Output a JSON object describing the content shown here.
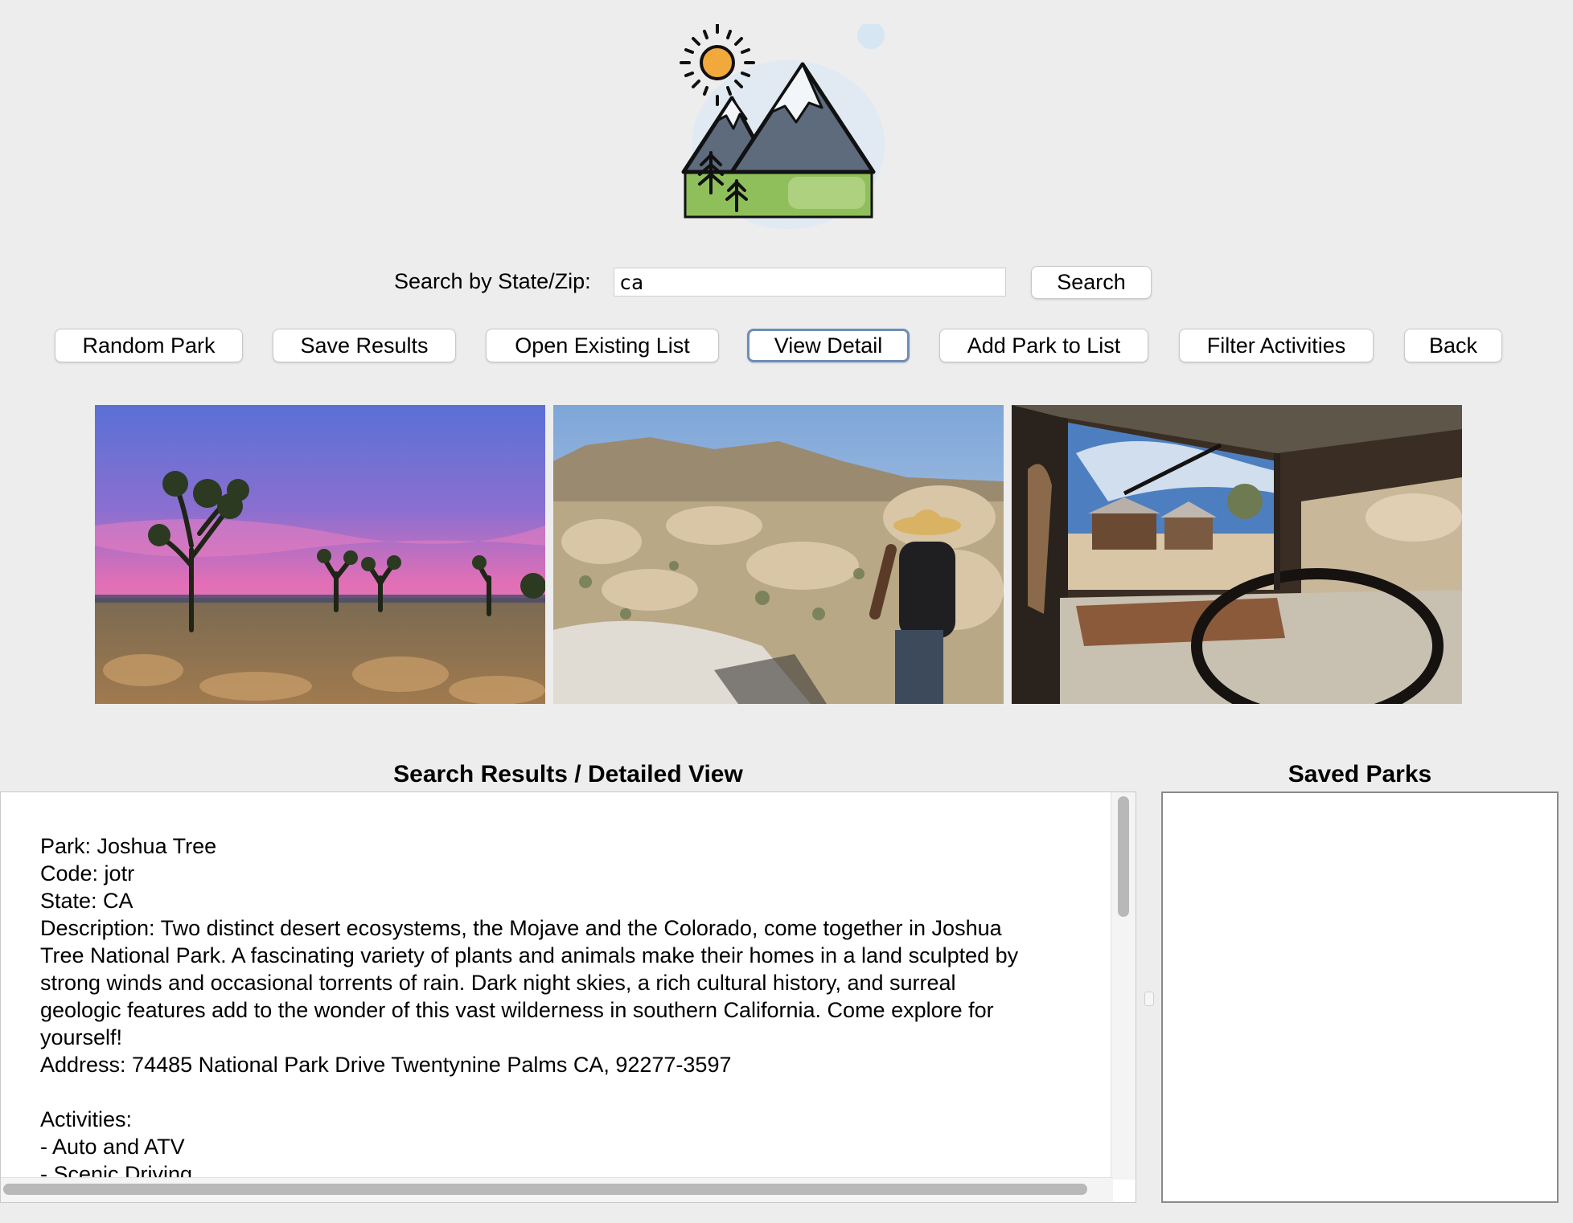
{
  "app": {
    "logo_icon": "mountains-sun-trees-logo-icon"
  },
  "search": {
    "label": "Search by State/Zip:",
    "value": "ca",
    "placeholder": "",
    "button_label": "Search"
  },
  "toolbar": {
    "random_park": "Random Park",
    "save_results": "Save Results",
    "open_existing_list": "Open Existing List",
    "view_detail": "View Detail",
    "add_park_to_list": "Add Park to List",
    "filter_activities": "Filter Activities",
    "back": "Back"
  },
  "photos": [
    {
      "icon": "joshua-tree-sunset-photo"
    },
    {
      "icon": "hiker-desert-rocks-photo"
    },
    {
      "icon": "old-truck-ghost-town-photo"
    }
  ],
  "results": {
    "title": "Search Results / Detailed View",
    "text": "Park: Joshua Tree\nCode: jotr\nState: CA\nDescription: Two distinct desert ecosystems, the Mojave and the Colorado, come together in Joshua\nTree National Park. A fascinating variety of plants and animals make their homes in a land sculpted by\nstrong winds and occasional torrents of rain. Dark night skies, a rich cultural history, and surreal\ngeologic features add to the wonder of this vast wilderness in southern California. Come explore for\nyourself!\nAddress: 74485 National Park Drive Twentynine Palms CA, 92277-3597\n\nActivities:\n- Auto and ATV\n- Scenic Driving"
  },
  "saved": {
    "title": "Saved Parks",
    "items": []
  },
  "colors": {
    "background": "#ededed",
    "focus_ring": "#6e8db8"
  }
}
